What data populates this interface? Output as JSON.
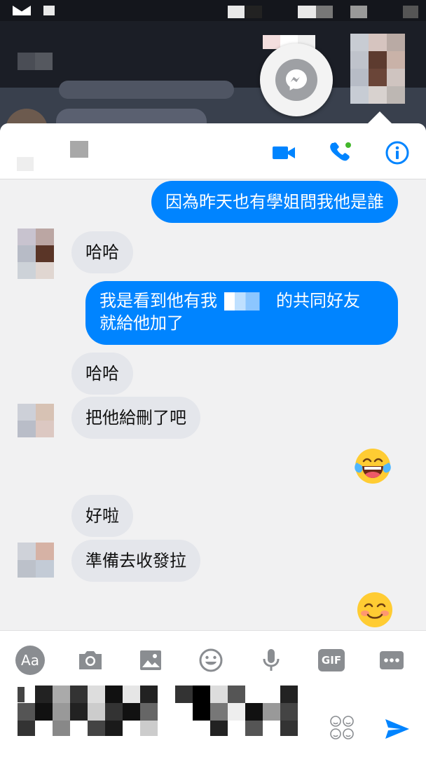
{
  "messages": [
    {
      "id": "m1",
      "from": "me",
      "text": "因為昨天也有學姐問我他是誰"
    },
    {
      "id": "m2",
      "from": "them",
      "text": "哈哈"
    },
    {
      "id": "m3",
      "from": "me",
      "line1_a": "我是看到他有我",
      "line1_b": "的共同好友",
      "line2": "就給他加了"
    },
    {
      "id": "m4",
      "from": "them",
      "text": "哈哈"
    },
    {
      "id": "m5",
      "from": "them",
      "text": "把他給刪了吧"
    },
    {
      "id": "m6",
      "from": "me",
      "emoji": "face-with-tears-of-joy"
    },
    {
      "id": "m7",
      "from": "them",
      "text": "好啦"
    },
    {
      "id": "m8",
      "from": "them",
      "text": "準備去收發拉"
    },
    {
      "id": "m9",
      "from": "me",
      "emoji": "smiling-face-with-smiling-eyes"
    }
  ],
  "composer": {
    "tools": [
      "Aa",
      "camera-icon",
      "image-icon",
      "emoji-icon",
      "microphone-icon",
      "GIF",
      "more-icon"
    ],
    "aa_label": "Aa",
    "gif_label": "GIF"
  },
  "colors": {
    "accent": "#0084ff",
    "received": "#e4e6eb",
    "background": "#f1f1f2"
  }
}
